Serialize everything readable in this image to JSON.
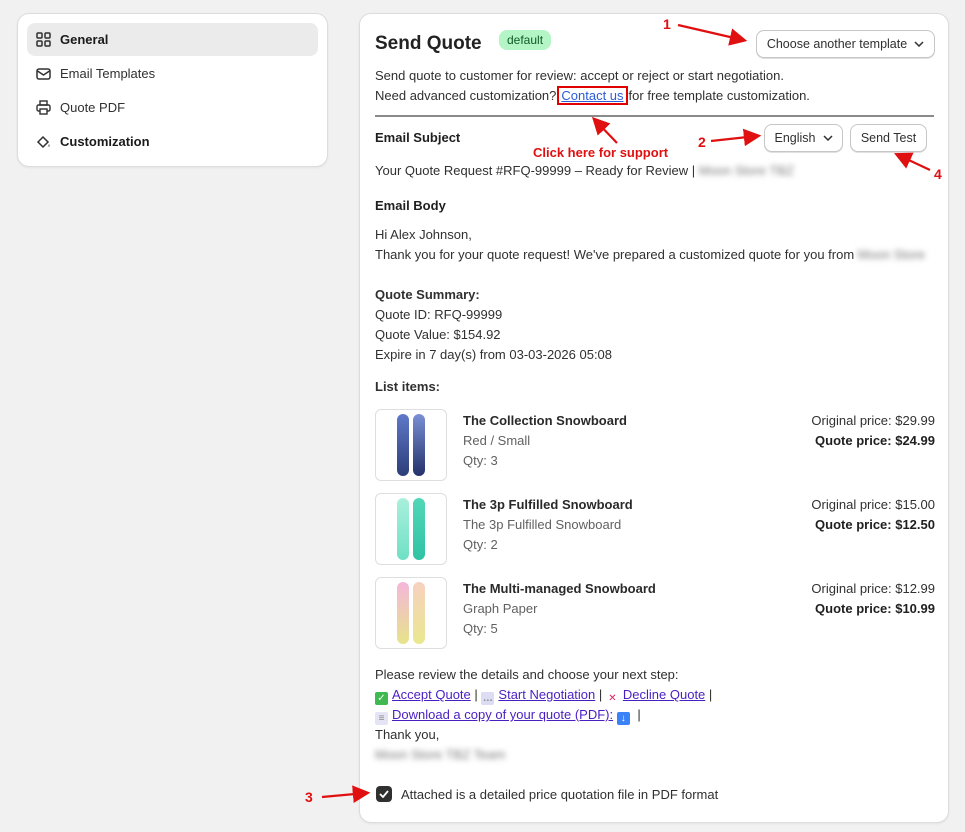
{
  "sidebar": {
    "items": [
      {
        "label": "General",
        "icon": "grid-icon",
        "active": true,
        "bold": true
      },
      {
        "label": "Email Templates",
        "icon": "envelope-icon",
        "active": false,
        "bold": false
      },
      {
        "label": "Quote PDF",
        "icon": "printer-icon",
        "active": false,
        "bold": false
      },
      {
        "label": "Customization",
        "icon": "paint-bucket-icon",
        "active": false,
        "bold": true
      }
    ]
  },
  "header": {
    "title": "Send Quote",
    "badge": "default",
    "template_button": "Choose another template"
  },
  "description": {
    "line1": "Send quote to customer for review: accept or reject or start negotiation.",
    "line2_before": "Need advanced customization?",
    "contact_link": "Contact us",
    "line2_after": "for free template customization."
  },
  "email_subject": {
    "heading": "Email Subject",
    "language": "English",
    "send_test": "Send Test",
    "value": "Your Quote Request #RFQ-99999 – Ready for Review |",
    "value_blurred": "Moon Store TBZ"
  },
  "email_body": {
    "heading": "Email Body",
    "greeting": "Hi Alex Johnson,",
    "thanks_line": "Thank you for your quote request! We've prepared a customized quote for you from",
    "thanks_blurred": "Moon Store",
    "summary_heading": "Quote Summary:",
    "quote_id": "Quote ID: RFQ-99999",
    "quote_value": "Quote Value: $154.92",
    "expire": "Expire in 7 day(s) from 03-03-2026 05:08",
    "list_heading": "List items:"
  },
  "items": [
    {
      "name": "The Collection Snowboard",
      "variant": "Red / Small",
      "qty": "Qty: 3",
      "original": "Original price: $29.99",
      "quote": "Quote price: $24.99",
      "colors": [
        "#3a4f8f",
        "#2c3d78"
      ]
    },
    {
      "name": "The 3p Fulfilled Snowboard",
      "variant": "The 3p Fulfilled Snowboard",
      "qty": "Qty: 2",
      "original": "Original price: $15.00",
      "quote": "Quote price: $12.50",
      "colors": [
        "#7fe3c9",
        "#3ccfb1"
      ]
    },
    {
      "name": "The Multi-managed Snowboard",
      "variant": "Graph Paper",
      "qty": "Qty: 5",
      "original": "Original price: $12.99",
      "quote": "Quote price: $10.99",
      "colors": [
        "#f1b9d8",
        "#e8e58a"
      ]
    }
  ],
  "footer": {
    "review_line": "Please review the details and choose your next step:",
    "accept": "Accept Quote",
    "negotiate": "Start Negotiation",
    "decline": "Decline Quote",
    "download": "Download a copy of your quote (PDF):",
    "sep": "|",
    "thank_you": "Thank you,",
    "team_blurred": "Moon Store TBZ Team",
    "checkbox_label": "Attached is a detailed price quotation file in PDF format",
    "checkbox_checked": true
  },
  "annotations": {
    "n1": "1",
    "n2": "2",
    "n3": "3",
    "n4": "4",
    "support_text": "Click here for support",
    "color": "#e01010"
  }
}
